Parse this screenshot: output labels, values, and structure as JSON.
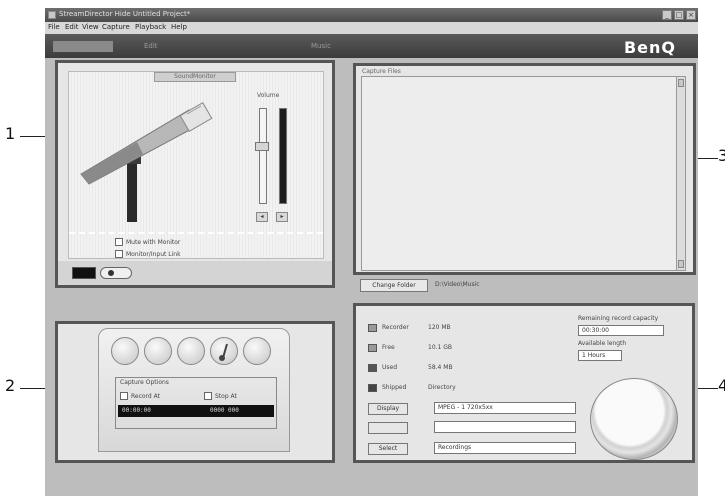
{
  "window": {
    "title": "StreamDirector Hide Untitled Project*",
    "controls": [
      "_",
      "□",
      "×"
    ]
  },
  "menu": [
    "File",
    "Edit",
    "View",
    "Capture",
    "Playback",
    "Help"
  ],
  "modes": [
    {
      "label": "",
      "active": true
    },
    {
      "label": "Edit",
      "active": false
    },
    {
      "label": "",
      "active": false
    },
    {
      "label": "Music",
      "active": false
    }
  ],
  "brand": "BenQ",
  "callouts": [
    "1",
    "2",
    "3",
    "4"
  ],
  "panel1": {
    "header": "SoundMonitor",
    "volume_label": "Volume",
    "volume_level": 0.6,
    "btn_left": "◂",
    "btn_right": "▸",
    "options": [
      "Mute with Monitor",
      "Monitor/Input Link"
    ]
  },
  "panel2": {
    "capture_label": "Capture Options",
    "opt1": "Record At",
    "opt2": "Stop At",
    "time1": "00:00:00",
    "time2": "0000 000"
  },
  "panel3": {
    "list_label": "Capture Files",
    "change_folder": "Change Folder",
    "folder_path": "D:\\Video\\Music"
  },
  "panel4": {
    "rows": [
      {
        "label": "Recorder",
        "value": "120 MB"
      },
      {
        "label": "Free",
        "value": "10.1 GB"
      },
      {
        "label": "Used",
        "value": "58.4 MB"
      },
      {
        "label": "Shipped",
        "value": "Directory"
      }
    ],
    "btn1": "Display",
    "btn2": "",
    "btn3": "Select",
    "field1": "MPEG - 1 720x5xx",
    "field2": "",
    "field3": "Recordings",
    "remaining_label": "Remaining record capacity",
    "remaining_value": "00:30:00",
    "available_label": "Available length",
    "available_value": "1 Hours"
  }
}
